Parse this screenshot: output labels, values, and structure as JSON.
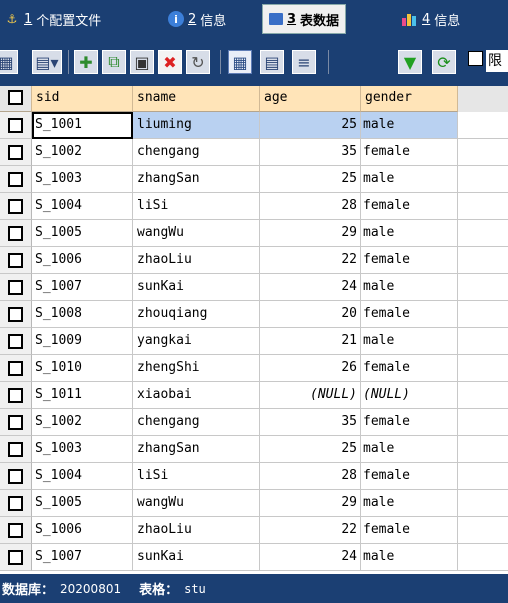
{
  "tabs": [
    {
      "num": "1",
      "label": "个配置文件",
      "icon": "user-key-icon",
      "active": false
    },
    {
      "num": "2",
      "label": "信息",
      "icon": "info-icon",
      "active": false
    },
    {
      "num": "3",
      "label": "表数据",
      "icon": "table-icon",
      "active": true
    },
    {
      "num": "4",
      "label": "信息",
      "icon": "chart-icon",
      "active": false
    }
  ],
  "toolbar": {
    "limit_label": "限",
    "icons": [
      "grid-add-icon",
      "export-dropdown-icon",
      "add-row-icon",
      "duplicate-row-icon",
      "save-icon",
      "delete-icon",
      "refresh-rows-icon",
      "grid-view-icon",
      "form-view-icon",
      "text-view-icon",
      "filter-icon",
      "refresh-icon",
      "limit-checkbox"
    ]
  },
  "grid": {
    "columns": [
      "sid",
      "sname",
      "age",
      "gender"
    ],
    "rows": [
      {
        "sid": "S_1001",
        "sname": "liuming",
        "age": "25",
        "gender": "male",
        "selected": true
      },
      {
        "sid": "S_1002",
        "sname": "chengang",
        "age": "35",
        "gender": "female"
      },
      {
        "sid": "S_1003",
        "sname": "zhangSan",
        "age": "25",
        "gender": "male"
      },
      {
        "sid": "S_1004",
        "sname": "liSi",
        "age": "28",
        "gender": "female"
      },
      {
        "sid": "S_1005",
        "sname": "wangWu",
        "age": "29",
        "gender": "male"
      },
      {
        "sid": "S_1006",
        "sname": "zhaoLiu",
        "age": "22",
        "gender": "female"
      },
      {
        "sid": "S_1007",
        "sname": "sunKai",
        "age": "24",
        "gender": "male"
      },
      {
        "sid": "S_1008",
        "sname": "zhouqiang",
        "age": "20",
        "gender": "female"
      },
      {
        "sid": "S_1009",
        "sname": "yangkai",
        "age": "21",
        "gender": "male"
      },
      {
        "sid": "S_1010",
        "sname": "zhengShi",
        "age": "26",
        "gender": "female"
      },
      {
        "sid": "S_1011",
        "sname": "xiaobai",
        "age": "(NULL)",
        "gender": "(NULL)"
      },
      {
        "sid": "S_1002",
        "sname": "chengang",
        "age": "35",
        "gender": "female"
      },
      {
        "sid": "S_1003",
        "sname": "zhangSan",
        "age": "25",
        "gender": "male"
      },
      {
        "sid": "S_1004",
        "sname": "liSi",
        "age": "28",
        "gender": "female"
      },
      {
        "sid": "S_1005",
        "sname": "wangWu",
        "age": "29",
        "gender": "male"
      },
      {
        "sid": "S_1006",
        "sname": "zhaoLiu",
        "age": "22",
        "gender": "female"
      },
      {
        "sid": "S_1007",
        "sname": "sunKai",
        "age": "24",
        "gender": "male"
      }
    ]
  },
  "status": {
    "db_label": "数据库：",
    "db_value": "20200801",
    "table_label": "表格：",
    "table_value": "stu"
  },
  "colors": {
    "chrome": "#1b3f73",
    "header_cell": "#ffe4b8",
    "selection": "#b9d1f1"
  }
}
